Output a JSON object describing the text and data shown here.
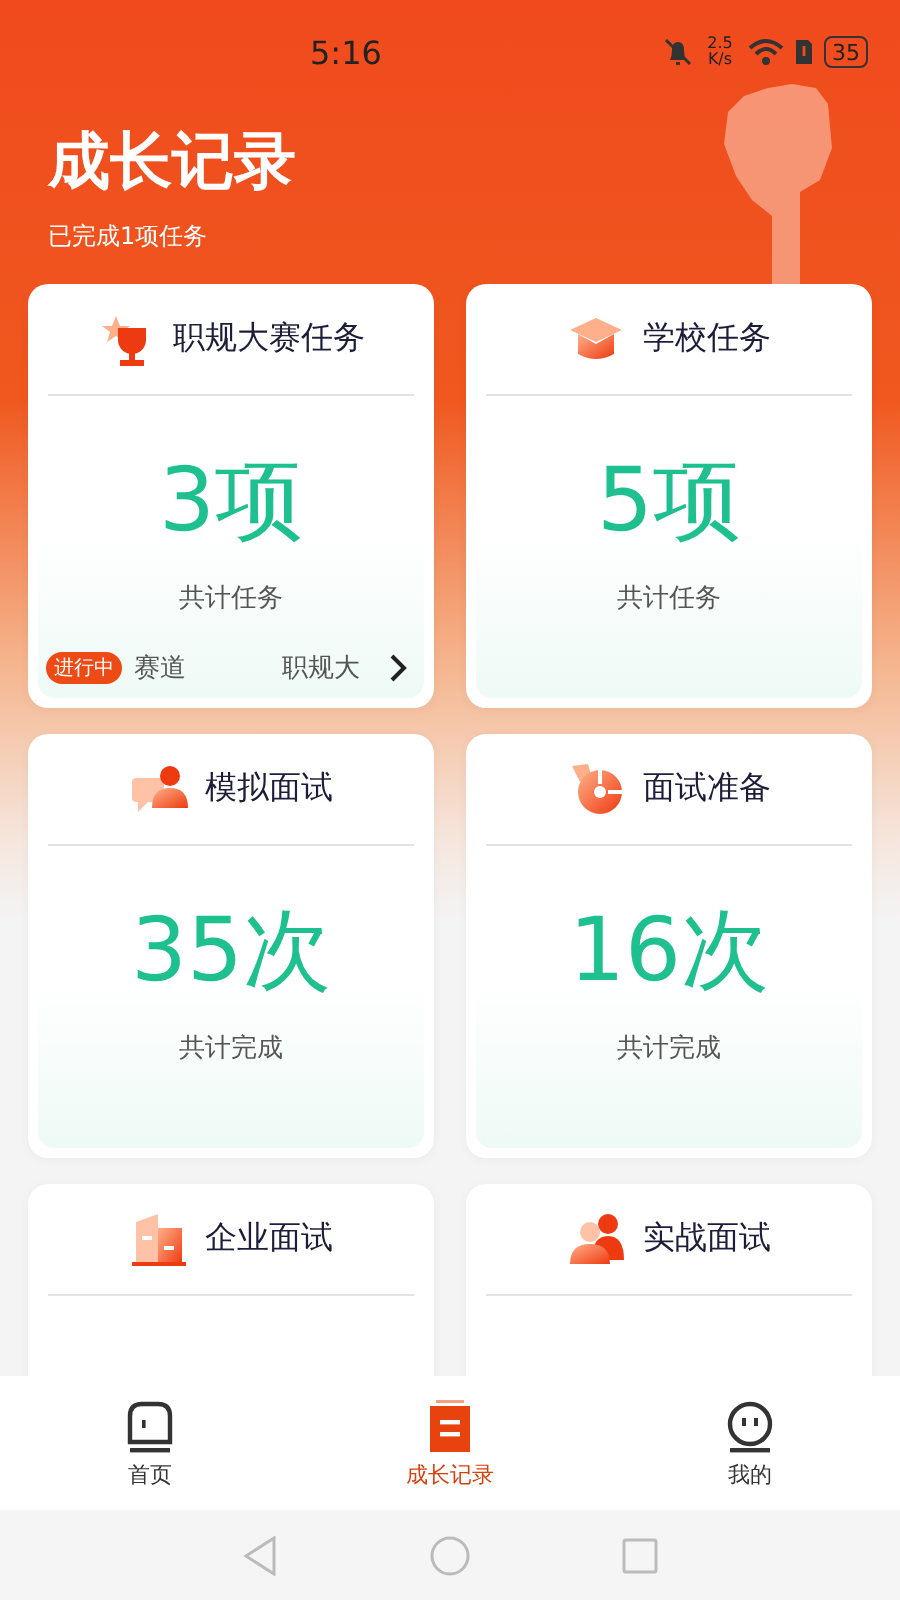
{
  "status_bar": {
    "time": "5:16",
    "net_speed": "2.5 K/s",
    "battery": "35"
  },
  "header": {
    "title": "成长记录",
    "subtitle": "已完成1项任务"
  },
  "cards": [
    {
      "kind": "trophy",
      "title": "职规大赛任务",
      "value": "3项",
      "caption": "共计任务",
      "ticker": {
        "badge": "进行中",
        "items": [
          "赛道",
          "职规大"
        ]
      }
    },
    {
      "kind": "cap",
      "title": "学校任务",
      "value": "5项",
      "caption": "共计任务"
    },
    {
      "kind": "chat",
      "title": "模拟面试",
      "value": "35次",
      "caption": "共计完成"
    },
    {
      "kind": "target",
      "title": "面试准备",
      "value": "16次",
      "caption": "共计完成"
    },
    {
      "kind": "building",
      "title": "企业面试"
    },
    {
      "kind": "people",
      "title": "实战面试"
    }
  ],
  "tabs": [
    {
      "kind": "home",
      "label": "首页",
      "selected": false
    },
    {
      "kind": "record",
      "label": "成长记录",
      "selected": true
    },
    {
      "kind": "me",
      "label": "我的",
      "selected": false
    }
  ]
}
